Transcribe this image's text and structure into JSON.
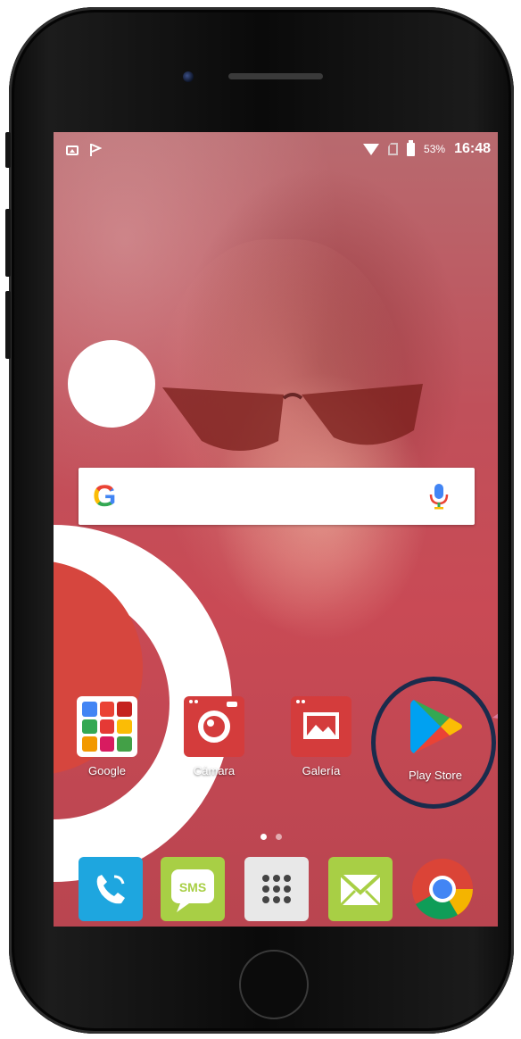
{
  "status_bar": {
    "notification_icons": [
      "image-icon",
      "flag-icon"
    ],
    "wifi_icon": "wifi-icon",
    "sim_icon": "no-sim-icon",
    "battery_icon": "battery-icon",
    "battery_percent": "53%",
    "time": "16:48"
  },
  "search_widget": {
    "logo": "G",
    "mic_icon": "mic-icon"
  },
  "apps": [
    {
      "label": "Google",
      "icon": "google-folder-icon"
    },
    {
      "label": "Cámara",
      "icon": "camera-icon"
    },
    {
      "label": "Galería",
      "icon": "gallery-icon"
    },
    {
      "label": "Play Store",
      "icon": "play-store-icon"
    }
  ],
  "page_indicator": {
    "pages": 2,
    "current": 1
  },
  "dock": [
    {
      "name": "phone",
      "icon": "phone-icon"
    },
    {
      "name": "sms",
      "label": "SMS",
      "icon": "sms-icon"
    },
    {
      "name": "app-drawer",
      "icon": "app-drawer-icon"
    },
    {
      "name": "email",
      "icon": "email-icon"
    },
    {
      "name": "chrome",
      "icon": "chrome-icon"
    }
  ],
  "colors": {
    "highlight_ring": "#1a2b4c",
    "accent_red": "#d43c3c",
    "pointer": "#e07a9a"
  }
}
